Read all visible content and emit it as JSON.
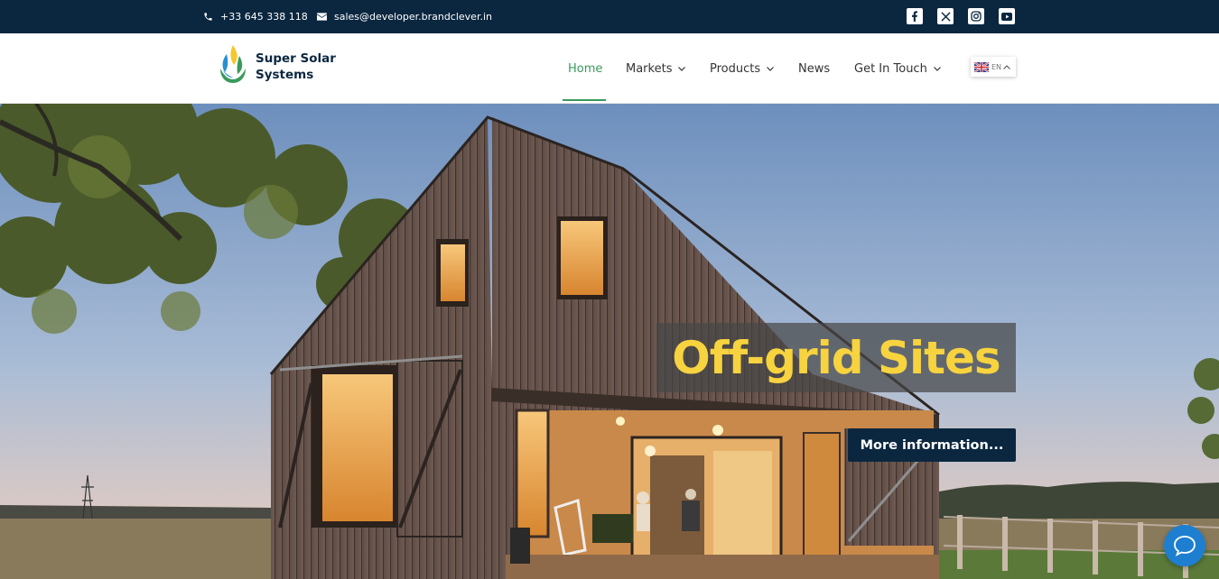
{
  "topbar": {
    "phone": "+33 645 338 118",
    "email": "sales@developer.brandclever.in",
    "socials": [
      "facebook-icon",
      "x-twitter-icon",
      "instagram-icon",
      "youtube-icon"
    ]
  },
  "header": {
    "brand_line1": "Super Solar",
    "brand_line2": "Systems",
    "nav": [
      {
        "label": "Home",
        "active": true
      },
      {
        "label": "Markets",
        "dropdown": true
      },
      {
        "label": "Products",
        "dropdown": true
      },
      {
        "label": "News"
      },
      {
        "label": "Get In Touch",
        "dropdown": true
      }
    ],
    "language": "EN"
  },
  "hero": {
    "headline": "Off-grid Sites",
    "cta_label": "More information..."
  },
  "colors": {
    "topbar_bg": "#0b2740",
    "accent_green": "#3a9a5b",
    "headline_yellow": "#f6d33f",
    "cta_bg": "#0b2740",
    "chat_blue": "#1e7fd0"
  }
}
